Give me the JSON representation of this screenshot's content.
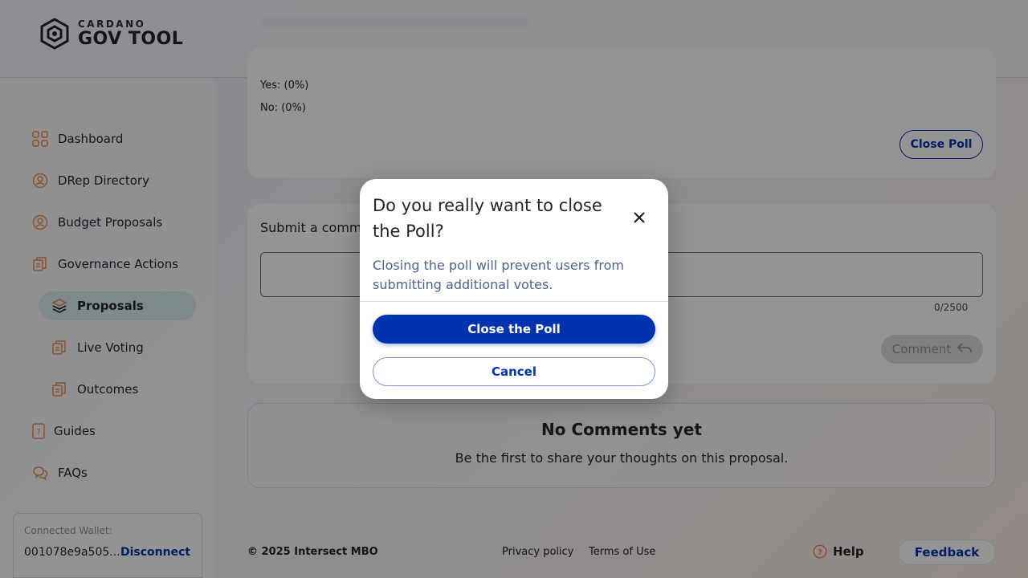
{
  "header": {
    "logo_small": "CARDANO",
    "logo_big": "GOV TOOL"
  },
  "sidebar": {
    "items": [
      {
        "label": "Dashboard",
        "icon": "dashboard-icon"
      },
      {
        "label": "DRep Directory",
        "icon": "drep-directory-icon"
      },
      {
        "label": "Budget Proposals",
        "icon": "budget-proposals-icon"
      },
      {
        "label": "Governance Actions",
        "icon": "governance-actions-icon"
      },
      {
        "label": "Proposals",
        "icon": "proposals-icon",
        "active": true
      },
      {
        "label": "Live Voting",
        "icon": "live-voting-icon"
      },
      {
        "label": "Outcomes",
        "icon": "outcomes-icon"
      },
      {
        "label": "Guides",
        "icon": "guides-icon"
      },
      {
        "label": "FAQs",
        "icon": "faqs-icon"
      }
    ],
    "wallet": {
      "label": "Connected Wallet:",
      "address": "001078e9a505...",
      "disconnect": "Disconnect"
    }
  },
  "poll": {
    "yes": "Yes: (0%)",
    "no": "No: (0%)",
    "close_button": "Close Poll"
  },
  "comment": {
    "title": "Submit a comm",
    "counter": "0/2500",
    "button": "Comment"
  },
  "empty": {
    "title": "No Comments yet",
    "subtitle": "Be the first to share your thoughts on this proposal."
  },
  "footer": {
    "copyright": "© 2025 Intersect MBO",
    "privacy": "Privacy policy",
    "terms": "Terms of Use",
    "help": "Help",
    "feedback": "Feedback"
  },
  "modal": {
    "title": "Do you really want to close the Poll?",
    "body": "Closing the poll will prevent users from submitting additional votes.",
    "confirm": "Close the Poll",
    "cancel": "Cancel"
  },
  "colors": {
    "primary": "#0033ad",
    "active_nav": "#d9ecf0",
    "icon_accent": "#f08a4b"
  }
}
